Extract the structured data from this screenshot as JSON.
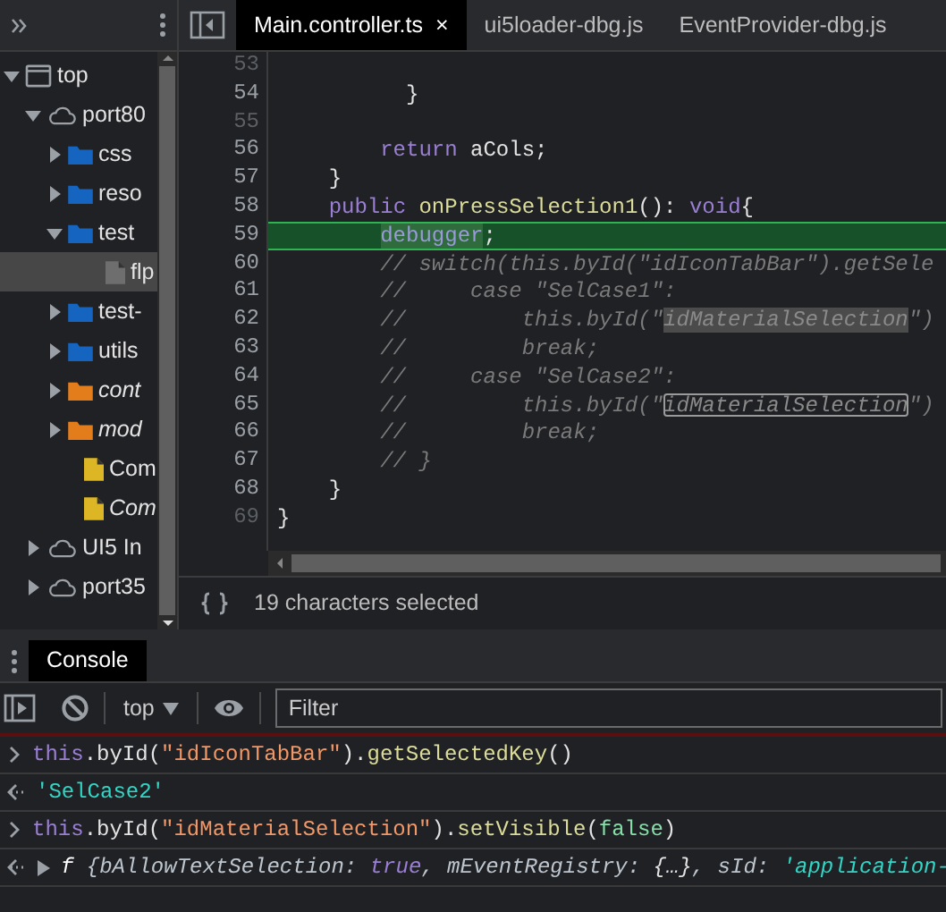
{
  "sidebar": {
    "tree": [
      {
        "label": "top",
        "kind": "frame",
        "expanded": true,
        "selected": false,
        "children": [
          {
            "label": "port80",
            "kind": "cloud",
            "expanded": true,
            "selected": false,
            "children": [
              {
                "label": "css",
                "kind": "folder",
                "color": "#1565c0",
                "expanded": false,
                "selected": false
              },
              {
                "label": "reso",
                "kind": "folder",
                "color": "#1565c0",
                "expanded": false,
                "selected": false
              },
              {
                "label": "test",
                "kind": "folder",
                "color": "#1565c0",
                "expanded": true,
                "selected": false,
                "children": [
                  {
                    "label": "flp",
                    "kind": "file",
                    "color": "#6e6e6e",
                    "selected": true
                  }
                ]
              },
              {
                "label": "test-",
                "kind": "folder",
                "color": "#1565c0",
                "expanded": false,
                "selected": false
              },
              {
                "label": "utils",
                "kind": "folder",
                "color": "#1565c0",
                "expanded": false,
                "selected": false
              },
              {
                "label": "cont",
                "kind": "folder",
                "color": "#e37d1c",
                "expanded": false,
                "selected": false,
                "overridden": true
              },
              {
                "label": "mod",
                "kind": "folder",
                "color": "#e37d1c",
                "expanded": false,
                "selected": false,
                "overridden": true
              },
              {
                "label": "Com",
                "kind": "file",
                "color": "#dcb625",
                "selected": false
              },
              {
                "label": "Com",
                "kind": "file",
                "color": "#dcb625",
                "selected": false,
                "overridden": true
              }
            ]
          },
          {
            "label": "UI5 In",
            "kind": "cloud",
            "expanded": false,
            "selected": false
          },
          {
            "label": "port35",
            "kind": "cloud",
            "expanded": false,
            "selected": false
          }
        ]
      }
    ]
  },
  "editor": {
    "tabs": [
      {
        "label": "Main.controller.ts",
        "selected": true,
        "close": "×"
      },
      {
        "label": "ui5loader-dbg.js",
        "selected": false
      },
      {
        "label": "EventProvider-dbg.js",
        "selected": false
      }
    ],
    "lines": [
      {
        "number": "53",
        "muted": true,
        "current": false
      },
      {
        "number": "54",
        "muted": false,
        "current": false,
        "segments": [
          {
            "kind": "plain",
            "text": "          }"
          }
        ]
      },
      {
        "number": "55",
        "muted": true,
        "current": false
      },
      {
        "number": "56",
        "muted": false,
        "current": false,
        "segments": [
          {
            "kind": "keyword",
            "text": "        return"
          },
          {
            "kind": "plain",
            "text": " aCols;"
          }
        ]
      },
      {
        "number": "57",
        "muted": false,
        "current": false,
        "segments": [
          {
            "kind": "plain",
            "text": "    }"
          }
        ]
      },
      {
        "number": "58",
        "muted": false,
        "current": false,
        "segments": [
          {
            "kind": "keyword",
            "text": "    public "
          },
          {
            "kind": "function",
            "text": "onPressSelection1"
          },
          {
            "kind": "plain",
            "text": "(): "
          },
          {
            "kind": "keyword",
            "text": "void"
          },
          {
            "kind": "plain",
            "text": "{"
          }
        ]
      },
      {
        "number": "59",
        "muted": false,
        "current": true,
        "segments": [
          {
            "kind": "word-match",
            "text": "        debugger"
          },
          {
            "kind": "plain",
            "text": ";"
          }
        ]
      },
      {
        "number": "60",
        "muted": false,
        "current": false,
        "segments": [
          {
            "kind": "comment",
            "text": "        // switch(this.byId(\"idIconTabBar\").getSele"
          }
        ]
      },
      {
        "number": "61",
        "muted": false,
        "current": false,
        "segments": [
          {
            "kind": "comment",
            "text": "        //     case \"SelCase1\":"
          }
        ]
      },
      {
        "number": "62",
        "muted": false,
        "current": false,
        "segments": [
          {
            "kind": "comment",
            "text": "        //         this.byId(\""
          },
          {
            "kind": "selection",
            "text": "idMaterialSelection"
          },
          {
            "kind": "comment",
            "text": "\")"
          }
        ]
      },
      {
        "number": "63",
        "muted": false,
        "current": false,
        "segments": [
          {
            "kind": "comment",
            "text": "        //         break;"
          }
        ]
      },
      {
        "number": "64",
        "muted": false,
        "current": false,
        "segments": [
          {
            "kind": "comment",
            "text": "        //     case \"SelCase2\":"
          }
        ]
      },
      {
        "number": "65",
        "muted": false,
        "current": false,
        "segments": [
          {
            "kind": "comment",
            "text": "        //         this.byId(\""
          },
          {
            "kind": "occurrence",
            "text": "idMaterialSelection"
          },
          {
            "kind": "comment",
            "text": "\")"
          }
        ]
      },
      {
        "number": "66",
        "muted": false,
        "current": false,
        "segments": [
          {
            "kind": "comment",
            "text": "        //         break;"
          }
        ]
      },
      {
        "number": "67",
        "muted": false,
        "current": false,
        "segments": [
          {
            "kind": "comment",
            "text": "        // }"
          }
        ]
      },
      {
        "number": "68",
        "muted": false,
        "current": false,
        "segments": [
          {
            "kind": "plain",
            "text": "    }"
          }
        ]
      },
      {
        "number": "69",
        "muted": true,
        "current": false,
        "segments": [
          {
            "kind": "plain",
            "text": "}"
          }
        ]
      }
    ],
    "status": "19 characters selected"
  },
  "drawer": {
    "tabs": [
      {
        "label": "Console",
        "selected": true
      }
    ]
  },
  "console": {
    "context": "top",
    "filter": {
      "placeholder": "Filter"
    },
    "messages": [
      {
        "kind": "input",
        "segments": [
          {
            "kind": "keyword",
            "text": "this"
          },
          {
            "kind": "plain",
            "text": ".byId("
          },
          {
            "kind": "string",
            "text": "\"idIconTabBar\""
          },
          {
            "kind": "plain",
            "text": ")."
          },
          {
            "kind": "function",
            "text": "getSelectedKey"
          },
          {
            "kind": "plain",
            "text": "()"
          }
        ]
      },
      {
        "kind": "output",
        "segments": [
          {
            "kind": "value",
            "text": "'SelCase2'"
          }
        ]
      },
      {
        "kind": "input",
        "segments": [
          {
            "kind": "keyword",
            "text": "this"
          },
          {
            "kind": "plain",
            "text": ".byId("
          },
          {
            "kind": "string",
            "text": "\"idMaterialSelection\""
          },
          {
            "kind": "plain",
            "text": ")."
          },
          {
            "kind": "function",
            "text": "setVisible"
          },
          {
            "kind": "plain",
            "text": "("
          },
          {
            "kind": "literal",
            "text": "false"
          },
          {
            "kind": "plain",
            "text": ")"
          }
        ]
      },
      {
        "kind": "object",
        "segments": [
          {
            "kind": "fn",
            "text": "f"
          },
          {
            "kind": "prop",
            "text": " {bAllowTextSelection: "
          },
          {
            "kind": "keyword",
            "text": "true"
          },
          {
            "kind": "prop",
            "text": ", mEventRegistry: "
          },
          {
            "kind": "plain",
            "text": "{…}"
          },
          {
            "kind": "prop",
            "text": ", sId: "
          },
          {
            "kind": "value",
            "text": "'application-"
          }
        ]
      }
    ]
  }
}
